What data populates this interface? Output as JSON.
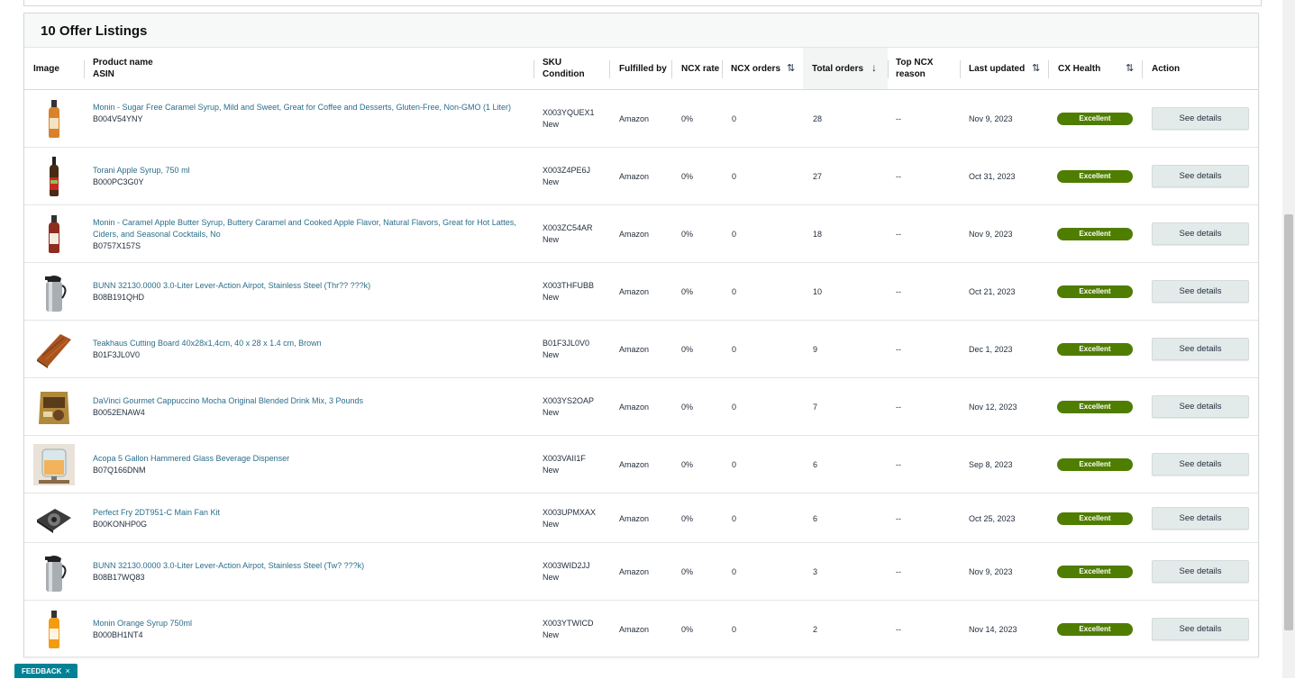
{
  "card": {
    "title": "10 Offer Listings"
  },
  "headers": {
    "image": "Image",
    "product_line1": "Product name",
    "product_line2": "ASIN",
    "sku_line1": "SKU",
    "sku_line2": "Condition",
    "fulfilled": "Fulfilled by",
    "ncx_rate": "NCX rate",
    "ncx_orders": "NCX orders",
    "total_orders": "Total orders",
    "top_ncx_line1": "Top NCX",
    "top_ncx_line2": "reason",
    "last_updated": "Last updated",
    "cx_health": "CX Health",
    "action": "Action"
  },
  "rows": [
    {
      "product": "Monin - Sugar Free Caramel Syrup, Mild and Sweet, Great for Coffee and Desserts, Gluten-Free, Non-GMO (1 Liter)",
      "asin": "B004V54YNY",
      "sku": "X003YQUEX1",
      "condition": "New",
      "fulfilled": "Amazon",
      "ncx_rate": "0%",
      "ncx_orders": "0",
      "total_orders": "28",
      "top_ncx": "--",
      "updated": "Nov 9, 2023",
      "health": "Excellent",
      "action": "See details",
      "thumb": "bottle-amber"
    },
    {
      "product": "Torani Apple Syrup, 750 ml",
      "asin": "B000PC3G0Y",
      "sku": "X003Z4PE6J",
      "condition": "New",
      "fulfilled": "Amazon",
      "ncx_rate": "0%",
      "ncx_orders": "0",
      "total_orders": "27",
      "top_ncx": "--",
      "updated": "Oct 31, 2023",
      "health": "Excellent",
      "action": "See details",
      "thumb": "bottle-dark"
    },
    {
      "product": "Monin - Caramel Apple Butter Syrup, Buttery Caramel and Cooked Apple Flavor, Natural Flavors, Great for Hot Lattes, Ciders, and Seasonal Cocktails, No",
      "asin": "B0757X157S",
      "sku": "X003ZC54AR",
      "condition": "New",
      "fulfilled": "Amazon",
      "ncx_rate": "0%",
      "ncx_orders": "0",
      "total_orders": "18",
      "top_ncx": "--",
      "updated": "Nov 9, 2023",
      "health": "Excellent",
      "action": "See details",
      "thumb": "bottle-red"
    },
    {
      "product": "BUNN 32130.0000 3.0-Liter Lever-Action Airpot, Stainless Steel (Thr?? ???k)",
      "asin": "B08B191QHD",
      "sku": "X003THFUBB",
      "condition": "New",
      "fulfilled": "Amazon",
      "ncx_rate": "0%",
      "ncx_orders": "0",
      "total_orders": "10",
      "top_ncx": "--",
      "updated": "Oct 21, 2023",
      "health": "Excellent",
      "action": "See details",
      "thumb": "airpot"
    },
    {
      "product": "Teakhaus Cutting Board 40x28x1,4cm, 40 x 28 x 1.4 cm, Brown",
      "asin": "B01F3JL0V0",
      "sku": "B01F3JL0V0",
      "condition": "New",
      "fulfilled": "Amazon",
      "ncx_rate": "0%",
      "ncx_orders": "0",
      "total_orders": "9",
      "top_ncx": "--",
      "updated": "Dec 1, 2023",
      "health": "Excellent",
      "action": "See details",
      "thumb": "board"
    },
    {
      "product": "DaVinci Gourmet Cappuccino Mocha Original Blended Drink Mix, 3 Pounds",
      "asin": "B0052ENAW4",
      "sku": "X003YS2OAP",
      "condition": "New",
      "fulfilled": "Amazon",
      "ncx_rate": "0%",
      "ncx_orders": "0",
      "total_orders": "7",
      "top_ncx": "--",
      "updated": "Nov 12, 2023",
      "health": "Excellent",
      "action": "See details",
      "thumb": "bag"
    },
    {
      "product": "Acopa 5 Gallon Hammered Glass Beverage Dispenser",
      "asin": "B07Q166DNM",
      "sku": "X003VAII1F",
      "condition": "New",
      "fulfilled": "Amazon",
      "ncx_rate": "0%",
      "ncx_orders": "0",
      "total_orders": "6",
      "top_ncx": "--",
      "updated": "Sep 8, 2023",
      "health": "Excellent",
      "action": "See details",
      "thumb": "dispenser"
    },
    {
      "product": "Perfect Fry 2DT951-C Main Fan Kit",
      "asin": "B00KONHP0G",
      "sku": "X003UPMXAX",
      "condition": "New",
      "fulfilled": "Amazon",
      "ncx_rate": "0%",
      "ncx_orders": "0",
      "total_orders": "6",
      "top_ncx": "--",
      "updated": "Oct 25, 2023",
      "health": "Excellent",
      "action": "See details",
      "thumb": "fan"
    },
    {
      "product": "BUNN 32130.0000 3.0-Liter Lever-Action Airpot, Stainless Steel (Tw? ???k)",
      "asin": "B08B17WQ83",
      "sku": "X003WID2JJ",
      "condition": "New",
      "fulfilled": "Amazon",
      "ncx_rate": "0%",
      "ncx_orders": "0",
      "total_orders": "3",
      "top_ncx": "--",
      "updated": "Nov 9, 2023",
      "health": "Excellent",
      "action": "See details",
      "thumb": "airpot"
    },
    {
      "product": "Monin Orange Syrup 750ml",
      "asin": "B000BH1NT4",
      "sku": "X003YTWICD",
      "condition": "New",
      "fulfilled": "Amazon",
      "ncx_rate": "0%",
      "ncx_orders": "0",
      "total_orders": "2",
      "top_ncx": "--",
      "updated": "Nov 14, 2023",
      "health": "Excellent",
      "action": "See details",
      "thumb": "bottle-orange"
    }
  ],
  "feedback": {
    "label": "FEEDBACK",
    "close": "×"
  },
  "colors": {
    "health": "#4f7d00",
    "link": "#2a6e8a",
    "feedback": "#008296"
  }
}
